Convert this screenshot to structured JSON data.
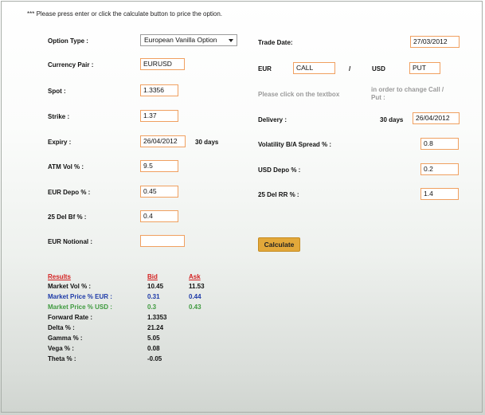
{
  "note": "*** Please press enter or click the calculate button to price the option.",
  "left": {
    "option_type_label": "Option Type :",
    "option_type_value": "European Vanilla Option",
    "currency_pair_label": "Currency Pair :",
    "currency_pair_value": "EURUSD",
    "spot_label": "Spot :",
    "spot_value": "1.3356",
    "strike_label": "Strike :",
    "strike_value": "1.37",
    "expiry_label": "Expiry :",
    "expiry_value": "26/04/2012",
    "expiry_days": "30 days",
    "atm_vol_label": "ATM Vol % :",
    "atm_vol_value": "9.5",
    "eur_depo_label": "EUR Depo % :",
    "eur_depo_value": "0.45",
    "del_bf_label": "25 Del Bf % :",
    "del_bf_value": "0.4",
    "eur_notional_label": "EUR Notional :",
    "eur_notional_value": ""
  },
  "right": {
    "trade_date_label": "Trade Date:",
    "trade_date_value": "27/03/2012",
    "eur_label": "EUR",
    "eur_value": "CALL",
    "slash": "/",
    "usd_label": "USD",
    "usd_value": "PUT",
    "hint_left": "Please click on the textbox",
    "hint_right_1": "in order to change Call /",
    "hint_right_2": "Put :",
    "delivery_label": "Delivery :",
    "delivery_days": "30 days",
    "delivery_value": "26/04/2012",
    "vol_spread_label": "Volatility B/A Spread % :",
    "vol_spread_value": "0.8",
    "usd_depo_label": "USD Depo % :",
    "usd_depo_value": "0.2",
    "del_rr_label": "25 Del RR % :",
    "del_rr_value": "1.4",
    "calculate_label": "Calculate"
  },
  "results": {
    "header": "Results",
    "bid_header": "Bid",
    "ask_header": "Ask",
    "rows": [
      {
        "label": "Market Vol % :",
        "bid": "10.45",
        "ask": "11.53",
        "color": "#111111"
      },
      {
        "label": "Market Price % EUR :",
        "bid": "0.31",
        "ask": "0.44",
        "color": "#1d3aa8"
      },
      {
        "label": "Market Price % USD :",
        "bid": "0.3",
        "ask": "0.43",
        "color": "#3f9a3f"
      },
      {
        "label": "Forward Rate :",
        "bid": "1.3353",
        "ask": "",
        "color": "#111111"
      },
      {
        "label": "Delta % :",
        "bid": "21.24",
        "ask": "",
        "color": "#111111"
      },
      {
        "label": "Gamma % :",
        "bid": "5.05",
        "ask": "",
        "color": "#111111"
      },
      {
        "label": "Vega % :",
        "bid": "0.08",
        "ask": "",
        "color": "#111111"
      },
      {
        "label": "Theta % :",
        "bid": "-0.05",
        "ask": "",
        "color": "#111111"
      }
    ]
  },
  "colors": {
    "input_border": "#f0a060",
    "button_bg": "#e2a83a",
    "results_header": "#d42020"
  }
}
